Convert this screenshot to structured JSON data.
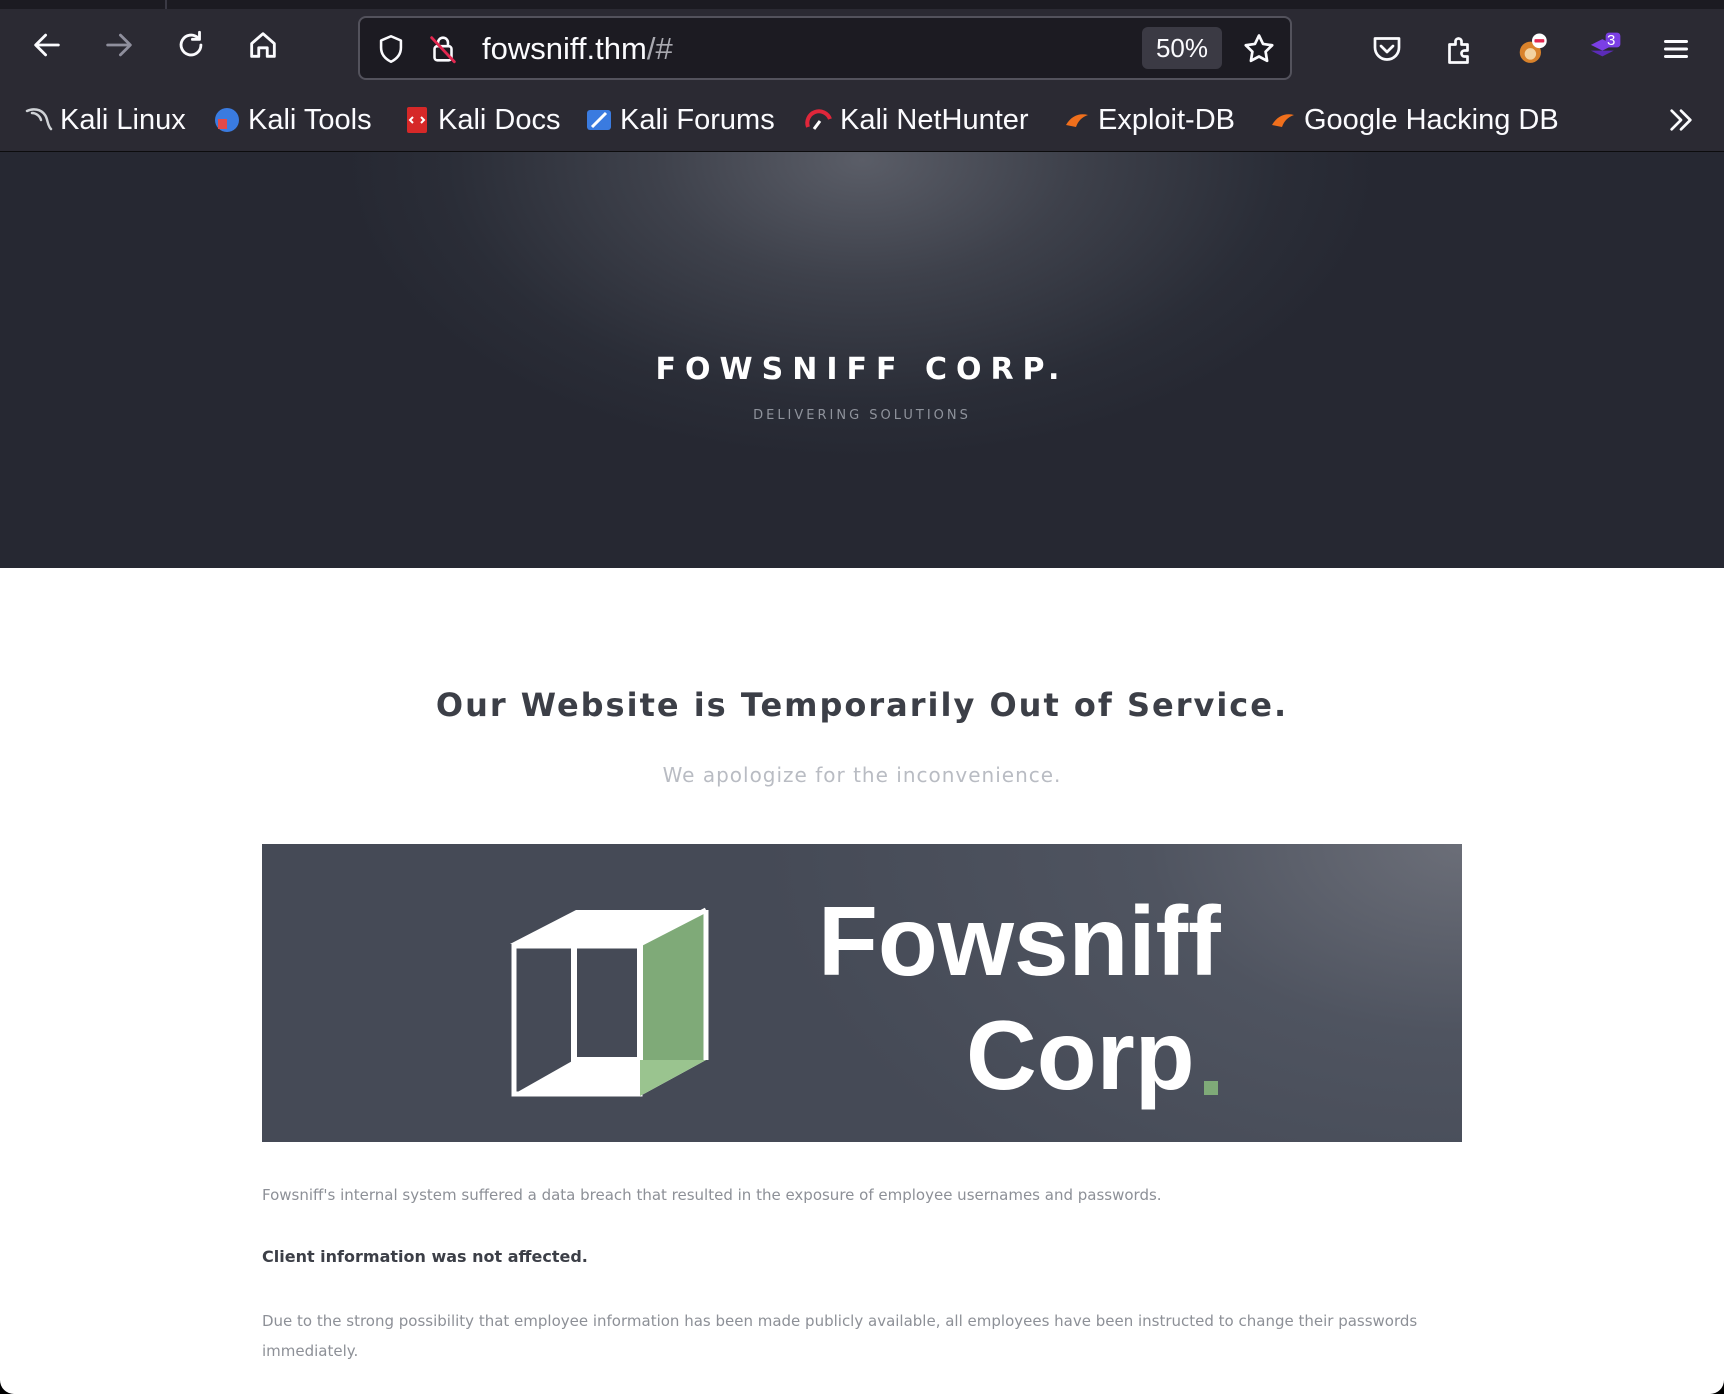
{
  "browser": {
    "url": {
      "host": "fowsniff.thm",
      "suffix": "/#"
    },
    "zoom": "50%",
    "extension_badge": "3",
    "icons": {
      "back": "back-arrow-icon",
      "forward": "forward-arrow-icon",
      "reload": "reload-icon",
      "home": "home-icon",
      "tracking": "shield-icon",
      "insecure": "insecure-lock-icon",
      "bookmark": "star-icon",
      "pocket": "pocket-icon",
      "extensions": "puzzle-icon",
      "menu": "hamburger-icon",
      "overflow": "chevron-double-right-icon"
    }
  },
  "bookmarks": [
    {
      "label": "Kali Linux",
      "icon": "kali-dragon-icon"
    },
    {
      "label": "Kali Tools",
      "icon": "kali-tools-icon"
    },
    {
      "label": "Kali Docs",
      "icon": "kali-docs-icon"
    },
    {
      "label": "Kali Forums",
      "icon": "kali-forums-icon"
    },
    {
      "label": "Kali NetHunter",
      "icon": "kali-nethunter-icon"
    },
    {
      "label": "Exploit-DB",
      "icon": "exploit-db-icon"
    },
    {
      "label": "Google Hacking DB",
      "icon": "ghdb-icon"
    }
  ],
  "page": {
    "hero": {
      "title": "FOWSNIFF CORP.",
      "subtitle": "DELIVERING SOLUTIONS"
    },
    "heading": "Our Website is Temporarily Out of Service.",
    "subheading": "We apologize for the inconvenience.",
    "banner": {
      "line1": "Fowsniff",
      "line2": "Corp"
    },
    "paragraphs": [
      "Fowsniff's internal system suffered a data breach that resulted in the exposure of employee usernames and passwords.",
      "Client information was not affected.",
      "Due to the strong possibility that employee information has been made publicly available, all employees have been instructed to change their passwords immediately."
    ]
  },
  "colors": {
    "toolbar": "#2b2a33",
    "hero_dark": "#2a2d37",
    "banner": "#4f5460",
    "cube_green": "#7faa78"
  }
}
